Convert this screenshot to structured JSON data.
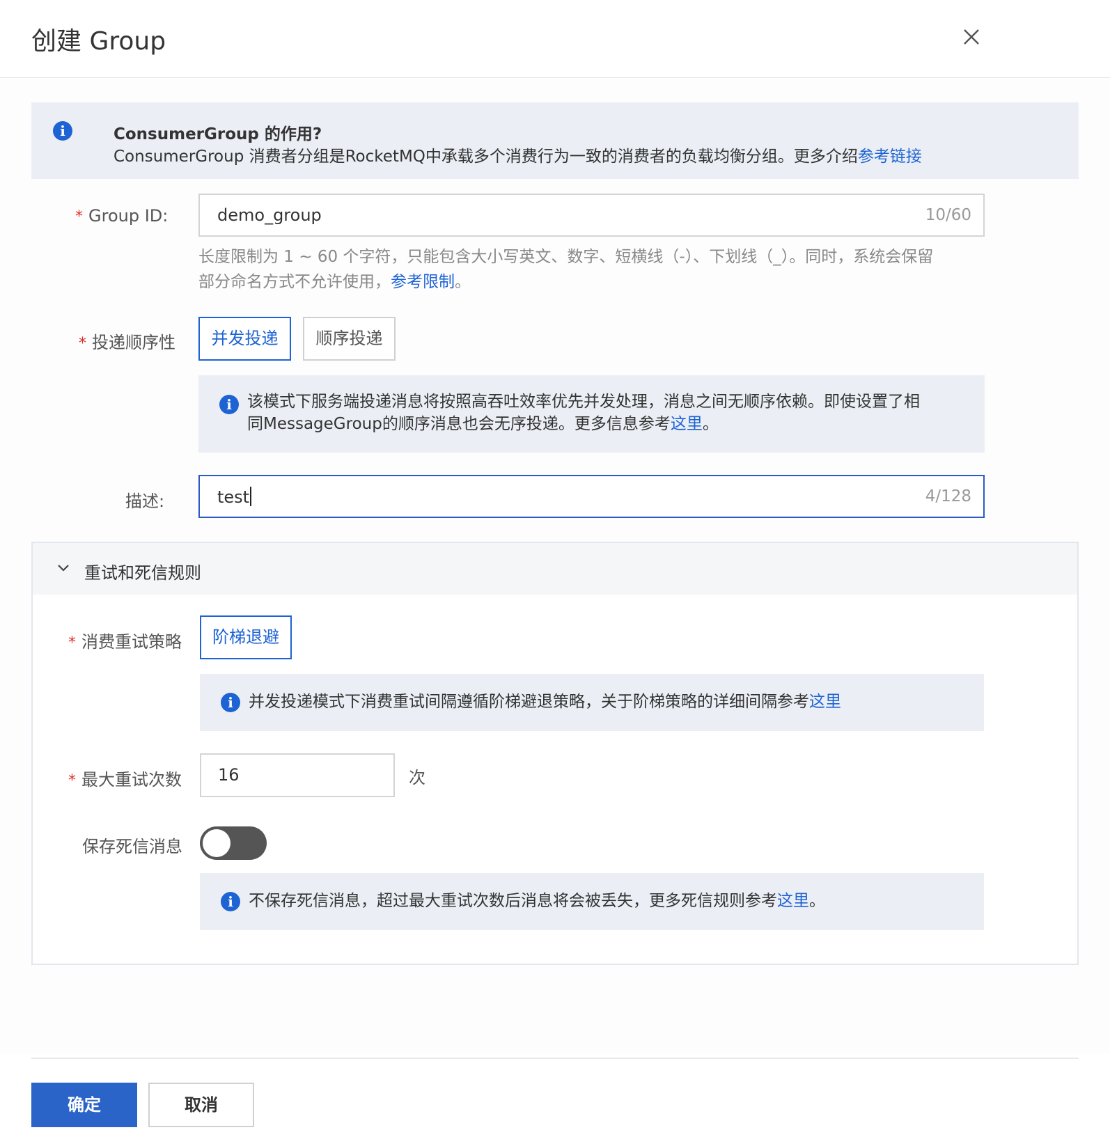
{
  "dialog": {
    "title": "创建 Group"
  },
  "banner": {
    "title": "ConsumerGroup 的作用?",
    "text": "ConsumerGroup 消费者分组是RocketMQ中承载多个消费行为一致的消费者的负载均衡分组。更多介绍",
    "link": "参考链接"
  },
  "group_id": {
    "required_mark": "*",
    "label": "Group ID:",
    "value": "demo_group",
    "count": "10/60",
    "help_line1": "长度限制为 1 ~ 60 个字符，只能包含大小写英文、数字、短横线（-）、下划线（_）。同时，系统会保留",
    "help_line2": "部分命名方式不允许使用，",
    "help_link": "参考限制",
    "help_end": "。"
  },
  "delivery": {
    "required_mark": "*",
    "label": "投递顺序性",
    "options": [
      "并发投递",
      "顺序投递"
    ],
    "selected": "并发投递",
    "note_line1": "该模式下服务端投递消息将按照高吞吐效率优先并发处理，消息之间无顺序依赖。即使设置了相",
    "note_line2": "同MessageGroup的顺序消息也会无序投递。更多信息参考",
    "note_link": "这里",
    "note_end": "。"
  },
  "description": {
    "label": "描述:",
    "value": "test",
    "count": "4/128"
  },
  "retry_section": {
    "title": "重试和死信规则",
    "strategy": {
      "required_mark": "*",
      "label": "消费重试策略",
      "option": "阶梯退避",
      "note": "并发投递模式下消费重试间隔遵循阶梯避退策略，关于阶梯策略的详细间隔参考",
      "note_link": "这里"
    },
    "max_retry": {
      "required_mark": "*",
      "label": "最大重试次数",
      "value": "16",
      "unit": "次"
    },
    "dead_letter": {
      "label": "保存死信消息",
      "enabled": false,
      "note": "不保存死信消息，超过最大重试次数后消息将会被丢失，更多死信规则参考",
      "note_link": "这里",
      "note_end": "。"
    }
  },
  "footer": {
    "confirm": "确定",
    "cancel": "取消"
  },
  "colors": {
    "primary": "#2a64c8",
    "link": "#1e63d4",
    "required": "#d93026",
    "info_bg": "#ebeff5"
  }
}
